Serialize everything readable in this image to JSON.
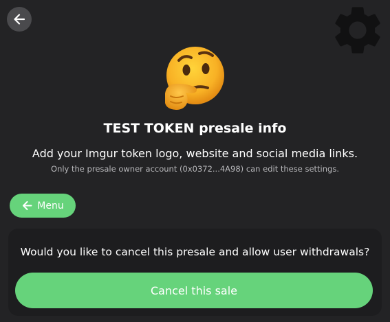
{
  "header": {
    "back_icon": "arrow-left-icon",
    "settings_icon": "gear-icon"
  },
  "hero": {
    "emoji": "thinking-face",
    "title": "TEST TOKEN presale info",
    "subtitle": "Add your Imgur token logo, website and social media links.",
    "note": "Only the presale owner account (0x0372...4A98) can edit these settings."
  },
  "menu_button": {
    "icon": "arrow-left-icon",
    "label": "Menu"
  },
  "cancel_card": {
    "question": "Would you like to cancel this presale and allow user withdrawals?",
    "button_label": "Cancel this sale"
  },
  "colors": {
    "background": "#232325",
    "card": "#1d1d1f",
    "accent_green": "#66d37b",
    "back_button": "#4a4a4d",
    "gear": "#111112"
  }
}
